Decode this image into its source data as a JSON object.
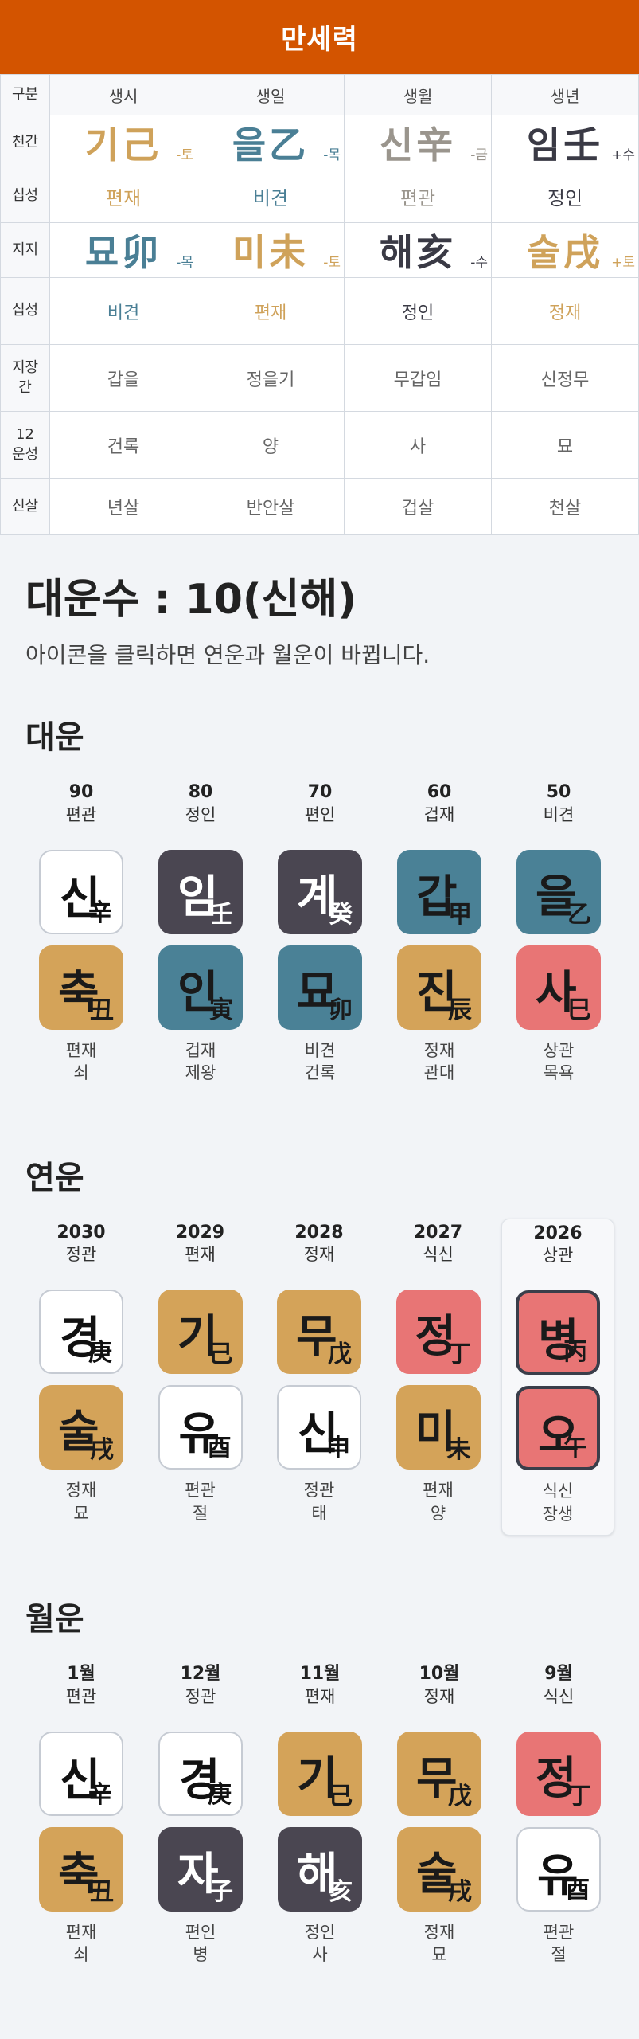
{
  "app": {
    "title": "만세력"
  },
  "saju": {
    "header": [
      "구분",
      "생시",
      "생일",
      "생월",
      "생년"
    ],
    "rows": {
      "cheongan": {
        "label": "천간",
        "cells": [
          {
            "char": "기己",
            "elem": "-토",
            "cls": "c-earth"
          },
          {
            "char": "을乙",
            "elem": "-목",
            "cls": "c-wood"
          },
          {
            "char": "신辛",
            "elem": "-금",
            "cls": "c-metal"
          },
          {
            "char": "임壬",
            "elem": "+수",
            "cls": "c-water"
          }
        ]
      },
      "sipsung1": {
        "label": "십성",
        "cells": [
          {
            "text": "편재",
            "cls": "c-earth"
          },
          {
            "text": "비견",
            "cls": "c-wood"
          },
          {
            "text": "편관",
            "cls": "c-metal"
          },
          {
            "text": "정인",
            "cls": "c-water"
          }
        ]
      },
      "jiji": {
        "label": "지지",
        "cells": [
          {
            "char": "묘卯",
            "elem": "-목",
            "cls": "c-wood"
          },
          {
            "char": "미未",
            "elem": "-토",
            "cls": "c-earth"
          },
          {
            "char": "해亥",
            "elem": "-수",
            "cls": "c-water"
          },
          {
            "char": "술戌",
            "elem": "+토",
            "cls": "c-earth"
          }
        ]
      },
      "sipsung2": {
        "label": "십성",
        "cells": [
          {
            "text": "비견",
            "cls": "c-wood"
          },
          {
            "text": "편재",
            "cls": "c-earth"
          },
          {
            "text": "정인",
            "cls": "c-water"
          },
          {
            "text": "정재",
            "cls": "c-earth"
          }
        ]
      },
      "jijanggan": {
        "label": "지장간",
        "cells": [
          "갑을",
          "정을기",
          "무갑임",
          "신정무"
        ]
      },
      "unsung": {
        "label": "12운성",
        "cells": [
          "건록",
          "양",
          "사",
          "묘"
        ]
      },
      "sinsal": {
        "label": "신살",
        "cells": [
          "년살",
          "반안살",
          "겁살",
          "천살"
        ]
      }
    }
  },
  "daeunsu": {
    "title": "대운수 : 10(신해)",
    "subtitle": "아이콘을 클릭하면 연운과 월운이 바뀝니다."
  },
  "daeun": {
    "title": "대운",
    "items": [
      {
        "top": "90",
        "sub": "편관",
        "stem": {
          "k": "신",
          "h": "辛",
          "color": "white"
        },
        "branch": {
          "k": "축",
          "h": "丑",
          "color": "gold"
        },
        "f1": "편재",
        "f2": "쇠"
      },
      {
        "top": "80",
        "sub": "정인",
        "stem": {
          "k": "임",
          "h": "壬",
          "color": "dark"
        },
        "branch": {
          "k": "인",
          "h": "寅",
          "color": "teal"
        },
        "f1": "겁재",
        "f2": "제왕"
      },
      {
        "top": "70",
        "sub": "편인",
        "stem": {
          "k": "계",
          "h": "癸",
          "color": "dark"
        },
        "branch": {
          "k": "묘",
          "h": "卯",
          "color": "teal"
        },
        "f1": "비견",
        "f2": "건록"
      },
      {
        "top": "60",
        "sub": "겁재",
        "stem": {
          "k": "갑",
          "h": "甲",
          "color": "teal"
        },
        "branch": {
          "k": "진",
          "h": "辰",
          "color": "gold"
        },
        "f1": "정재",
        "f2": "관대"
      },
      {
        "top": "50",
        "sub": "비견",
        "stem": {
          "k": "을",
          "h": "乙",
          "color": "teal"
        },
        "branch": {
          "k": "사",
          "h": "巳",
          "color": "red"
        },
        "f1": "상관",
        "f2": "목욕"
      }
    ]
  },
  "yeonun": {
    "title": "연운",
    "items": [
      {
        "top": "2030",
        "sub": "정관",
        "stem": {
          "k": "경",
          "h": "庚",
          "color": "white"
        },
        "branch": {
          "k": "술",
          "h": "戌",
          "color": "gold"
        },
        "f1": "정재",
        "f2": "묘"
      },
      {
        "top": "2029",
        "sub": "편재",
        "stem": {
          "k": "기",
          "h": "己",
          "color": "gold"
        },
        "branch": {
          "k": "유",
          "h": "酉",
          "color": "white"
        },
        "f1": "편관",
        "f2": "절"
      },
      {
        "top": "2028",
        "sub": "정재",
        "stem": {
          "k": "무",
          "h": "戊",
          "color": "gold"
        },
        "branch": {
          "k": "신",
          "h": "申",
          "color": "white"
        },
        "f1": "정관",
        "f2": "태"
      },
      {
        "top": "2027",
        "sub": "식신",
        "stem": {
          "k": "정",
          "h": "丁",
          "color": "red"
        },
        "branch": {
          "k": "미",
          "h": "未",
          "color": "gold"
        },
        "f1": "편재",
        "f2": "양"
      },
      {
        "top": "2026",
        "sub": "상관",
        "stem": {
          "k": "병",
          "h": "丙",
          "color": "red"
        },
        "branch": {
          "k": "오",
          "h": "午",
          "color": "red"
        },
        "f1": "식신",
        "f2": "장생",
        "selected": true
      }
    ]
  },
  "wolun": {
    "title": "월운",
    "items": [
      {
        "top": "1월",
        "sub": "편관",
        "stem": {
          "k": "신",
          "h": "辛",
          "color": "white"
        },
        "branch": {
          "k": "축",
          "h": "丑",
          "color": "gold"
        },
        "f1": "편재",
        "f2": "쇠"
      },
      {
        "top": "12월",
        "sub": "정관",
        "stem": {
          "k": "경",
          "h": "庚",
          "color": "white"
        },
        "branch": {
          "k": "자",
          "h": "子",
          "color": "dark"
        },
        "f1": "편인",
        "f2": "병"
      },
      {
        "top": "11월",
        "sub": "편재",
        "stem": {
          "k": "기",
          "h": "己",
          "color": "gold"
        },
        "branch": {
          "k": "해",
          "h": "亥",
          "color": "dark"
        },
        "f1": "정인",
        "f2": "사"
      },
      {
        "top": "10월",
        "sub": "정재",
        "stem": {
          "k": "무",
          "h": "戊",
          "color": "gold"
        },
        "branch": {
          "k": "술",
          "h": "戌",
          "color": "gold"
        },
        "f1": "정재",
        "f2": "묘"
      },
      {
        "top": "9월",
        "sub": "식신",
        "stem": {
          "k": "정",
          "h": "丁",
          "color": "red"
        },
        "branch": {
          "k": "유",
          "h": "酉",
          "color": "white"
        },
        "f1": "편관",
        "f2": "절"
      }
    ]
  }
}
